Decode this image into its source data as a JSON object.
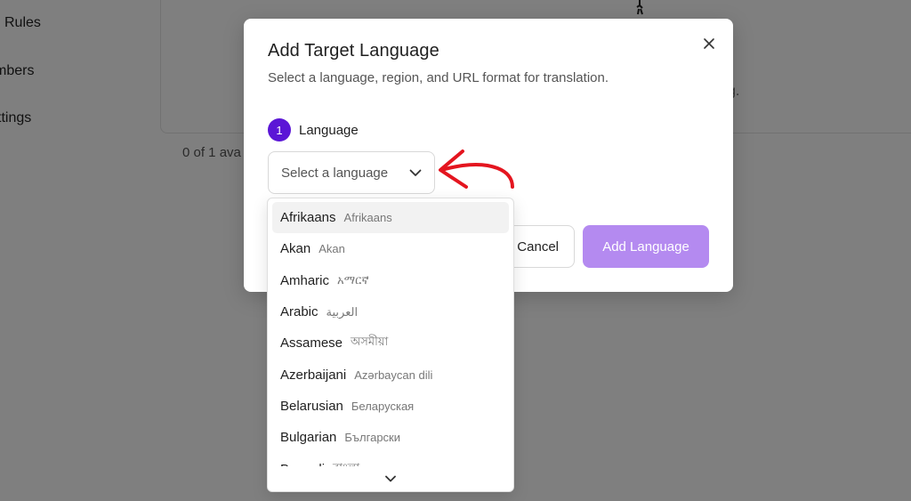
{
  "background": {
    "nav": [
      "Rules",
      "mbers",
      "ttings"
    ],
    "card_title": "l",
    "card_subtitle": "g.",
    "count_text": "0 of 1 ava"
  },
  "modal": {
    "title": "Add Target Language",
    "subtitle": "Select a language, region, and URL format for translation.",
    "close_icon": "close-icon",
    "step": {
      "number": "1",
      "label": "Language"
    },
    "select": {
      "placeholder": "Select a language",
      "icon": "chevron-down-icon"
    },
    "buttons": {
      "cancel": "Cancel",
      "add": "Add Language"
    }
  },
  "dropdown": {
    "items": [
      {
        "name": "Afrikaans",
        "native": "Afrikaans"
      },
      {
        "name": "Akan",
        "native": "Akan"
      },
      {
        "name": "Amharic",
        "native": "አማርኛ"
      },
      {
        "name": "Arabic",
        "native": "العربية"
      },
      {
        "name": "Assamese",
        "native": "অসমীয়া"
      },
      {
        "name": "Azerbaijani",
        "native": "Azərbaycan dili"
      },
      {
        "name": "Belarusian",
        "native": "Беларуская"
      },
      {
        "name": "Bulgarian",
        "native": "Български"
      },
      {
        "name": "Bengali",
        "native": "বাংলা"
      }
    ],
    "scroll_icon": "chevron-down-icon"
  },
  "colors": {
    "accent": "#5b16d6",
    "primary_button_disabled": "#b48af0",
    "annotation_arrow": "#e4151f"
  }
}
